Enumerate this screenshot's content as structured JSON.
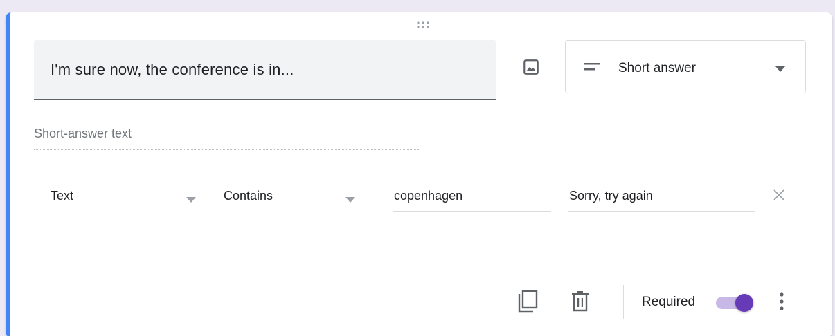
{
  "question": {
    "title": "I'm sure now, the conference is in..."
  },
  "question_type": {
    "selected": "Short answer",
    "icon": "short-text-icon"
  },
  "answer_placeholder": "Short-answer text",
  "validation": {
    "type": "Text",
    "condition": "Contains",
    "value": "copenhagen",
    "error_text": "Sorry, try again"
  },
  "footer": {
    "required_label": "Required",
    "required_on": true
  },
  "colors": {
    "accent": "#4285f4",
    "toggle": "#673ab7"
  }
}
